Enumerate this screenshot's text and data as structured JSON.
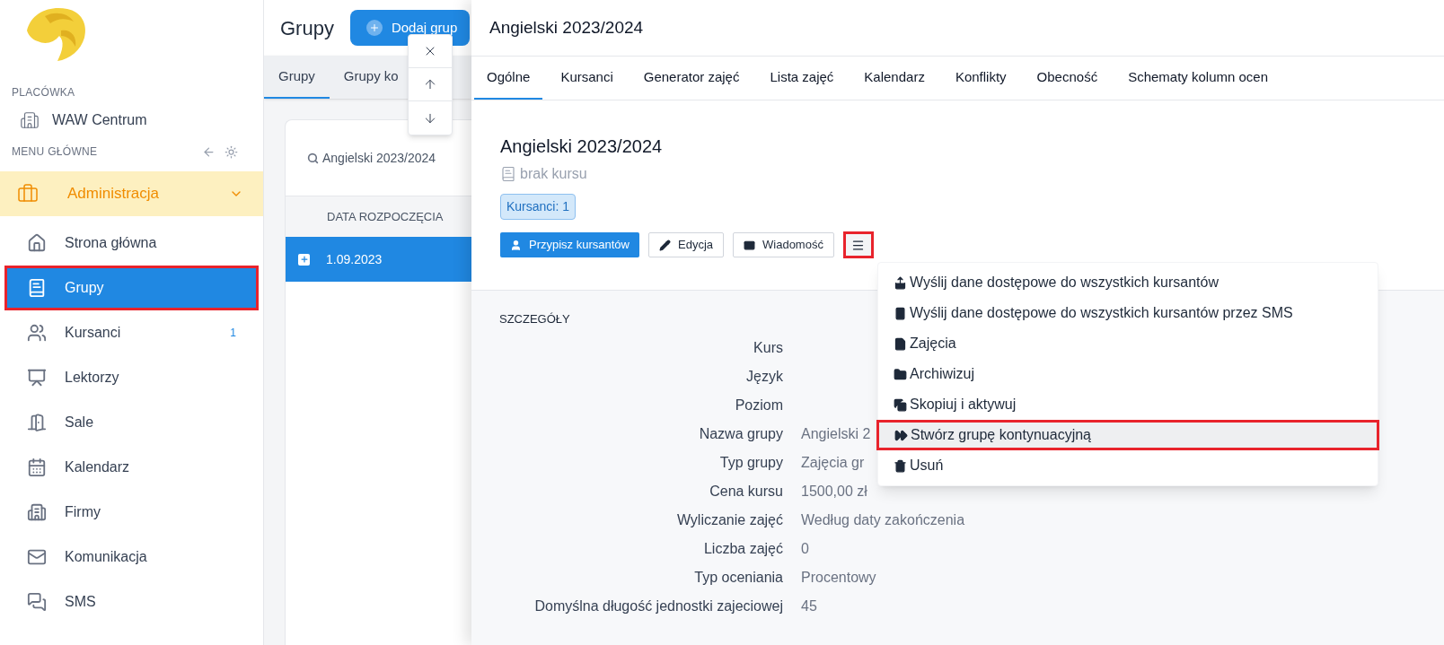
{
  "sidebar": {
    "branch_label": "PLACÓWKA",
    "branch": "WAW Centrum",
    "menu_label": "MENU GŁÓWNE",
    "section": {
      "label": "Administracja",
      "expanded": true
    },
    "items": [
      {
        "kind": "home",
        "label": "Strona główna",
        "selected": false,
        "marked": false
      },
      {
        "kind": "book",
        "label": "Grupy",
        "selected": true,
        "marked": true
      },
      {
        "kind": "users",
        "label": "Kursanci",
        "selected": false,
        "marked": false,
        "count": "1"
      },
      {
        "kind": "teacher",
        "label": "Lektorzy",
        "selected": false,
        "marked": false
      },
      {
        "kind": "door",
        "label": "Sale",
        "selected": false,
        "marked": false
      },
      {
        "kind": "calendar",
        "label": "Kalendarz",
        "selected": false,
        "marked": false
      },
      {
        "kind": "company",
        "label": "Firmy",
        "selected": false,
        "marked": false
      },
      {
        "kind": "mail",
        "label": "Komunikacja",
        "selected": false,
        "marked": false
      },
      {
        "kind": "chat",
        "label": "SMS",
        "selected": false,
        "marked": false
      }
    ]
  },
  "groups": {
    "title": "Grupy",
    "add_button": "Dodaj grup",
    "tabs": [
      {
        "label": "Grupy",
        "selected": true
      },
      {
        "label": "Grupy ko",
        "selected": false
      }
    ],
    "search": "Angielski 2023/2024",
    "column": "DATA ROZPOCZĘCIA",
    "rows": [
      {
        "date": "1.09.2023",
        "selected": true
      }
    ]
  },
  "drawer": {
    "title": "Angielski 2023/2024",
    "tabs": [
      {
        "label": "Ogólne",
        "selected": true
      },
      {
        "label": "Kursanci",
        "selected": false
      },
      {
        "label": "Generator zajęć",
        "selected": false
      },
      {
        "label": "Lista zajęć",
        "selected": false
      },
      {
        "label": "Kalendarz",
        "selected": false
      },
      {
        "label": "Konflikty",
        "selected": false
      },
      {
        "label": "Obecność",
        "selected": false
      },
      {
        "label": "Schematy kolumn ocen",
        "selected": false
      }
    ],
    "heading": "Angielski 2023/2024",
    "course": "brak kursu",
    "badge": "Kursanci: 1",
    "buttons": [
      {
        "kind": "primary",
        "label": "Przypisz kursantów"
      },
      {
        "kind": "edit",
        "label": "Edycja"
      },
      {
        "kind": "message",
        "label": "Wiadomość"
      }
    ],
    "menu_button": {
      "expanded": true,
      "marked": true
    },
    "menu": [
      {
        "kind": "share",
        "label": "Wyślij dane dostępowe do wszystkich kursantów",
        "selected": false,
        "marked": false
      },
      {
        "kind": "phone",
        "label": "Wyślij dane dostępowe do wszystkich kursantów przez SMS",
        "selected": false,
        "marked": false
      },
      {
        "kind": "file",
        "label": "Zajęcia",
        "selected": false,
        "marked": false
      },
      {
        "kind": "folder",
        "label": "Archiwizuj",
        "selected": false,
        "marked": false
      },
      {
        "kind": "copy",
        "label": "Skopiuj i aktywuj",
        "selected": false,
        "marked": false
      },
      {
        "kind": "forward",
        "label": "Stwórz grupę kontynuacyjną",
        "selected": true,
        "marked": true
      },
      {
        "kind": "trash",
        "label": "Usuń",
        "selected": false,
        "marked": false
      }
    ],
    "details_title": "SZCZEGÓŁY",
    "details": [
      {
        "label": "Kurs"
      },
      {
        "label": "Język"
      },
      {
        "label": "Poziom"
      },
      {
        "label": "Nazwa grupy",
        "value": "Angielski 2"
      },
      {
        "label": "Typ grupy",
        "value": "Zajęcia gr"
      },
      {
        "label": "Cena kursu",
        "value": "1500,00 zł"
      },
      {
        "label": "Wyliczanie zajęć",
        "value": "Według daty zakończenia"
      },
      {
        "label": "Liczba zajęć",
        "value": "0"
      },
      {
        "label": "Typ oceniania",
        "value": "Procentowy"
      },
      {
        "label": "Domyślna długość jednostki zajeciowej",
        "value": "45"
      }
    ]
  }
}
